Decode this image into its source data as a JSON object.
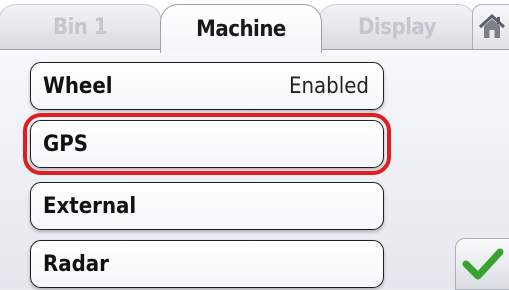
{
  "tabs": [
    {
      "label": "Bin 1",
      "state": "inactive"
    },
    {
      "label": "Machine",
      "state": "active"
    },
    {
      "label": "Display",
      "state": "inactive"
    }
  ],
  "home_icon": "home-icon",
  "rows": [
    {
      "label": "Wheel",
      "value": "Enabled"
    },
    {
      "label": "GPS",
      "value": "",
      "selected": true
    },
    {
      "label": "External",
      "value": ""
    },
    {
      "label": "Radar",
      "value": ""
    }
  ],
  "confirm_icon": "checkmark-icon",
  "colors": {
    "selection_outline": "#e11d24",
    "checkmark": "#3aa22f"
  }
}
